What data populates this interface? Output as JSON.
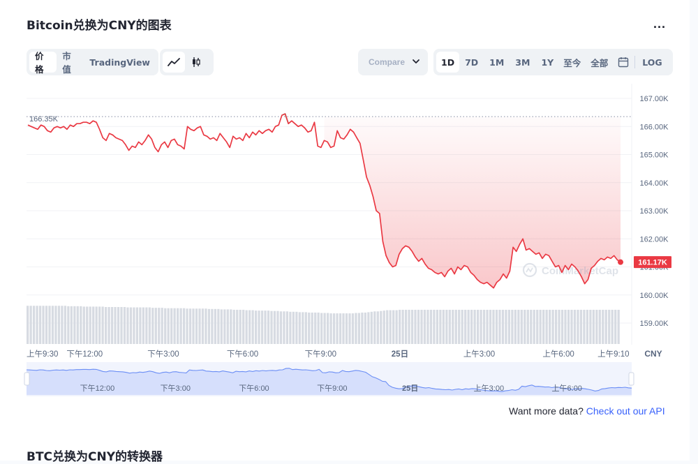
{
  "page": {
    "title": "Bitcoin兑换为CNY的图表",
    "more_label": "...",
    "view_tabs": [
      "价格",
      "市值",
      "TradingView"
    ],
    "compare_placeholder": "Compare",
    "ranges": [
      "1D",
      "7D",
      "1M",
      "3M",
      "1Y",
      "至今",
      "全部"
    ],
    "log_label": "LOG",
    "currency_label": "CNY",
    "watermark": "CoinMarketCap",
    "footer_text": "Want more data?",
    "footer_link": "Check out our API",
    "bottom_title": "BTC兑换为CNY的转换器"
  },
  "colors": {
    "line": "#ea3943",
    "accent": "#3861fb",
    "up": "#16c784",
    "brush": "#3861fb"
  },
  "icons": {
    "line_chart": "line-chart-icon",
    "candlestick": "candlestick-icon",
    "calendar": "calendar-icon",
    "chevron": "chevron-down-icon"
  },
  "chart_data": {
    "type": "line",
    "ylim": [
      158.5,
      167.5
    ],
    "yticks": [
      "167.00K",
      "166.00K",
      "165.00K",
      "164.00K",
      "163.00K",
      "162.00K",
      "161.00K",
      "160.00K",
      "159.00K"
    ],
    "ytick_values": [
      167,
      166,
      165,
      164,
      163,
      162,
      161,
      160,
      159
    ],
    "xticks": [
      "上午9:30",
      "下午12:00",
      "下午3:00",
      "下午6:00",
      "下午9:00",
      "25日",
      "上午3:00",
      "上午6:00",
      "上午9:10"
    ],
    "xticks_t": [
      0,
      0.096,
      0.226,
      0.357,
      0.486,
      0.617,
      0.748,
      0.879,
      0.996
    ],
    "brush_ticks": [
      "下午12:00",
      "下午3:00",
      "下午6:00",
      "下午9:00",
      "25日",
      "上午3:00",
      "上午6:00"
    ],
    "brush_ticks_t": [
      0.117,
      0.246,
      0.376,
      0.505,
      0.634,
      0.764,
      0.893
    ],
    "open_label": "166.35K",
    "open_value": 166.35,
    "current_label": "161.17K",
    "current_value": 161.17,
    "series": [
      {
        "values": [
          166.05,
          166.0,
          165.95,
          165.9,
          166.05,
          166.0,
          165.85,
          165.8,
          165.95,
          166.0,
          165.95,
          166.0,
          165.9,
          166.05,
          166.0,
          166.1,
          166.1,
          166.15,
          166.15,
          166.1,
          166.2,
          166.15,
          165.9,
          165.6,
          165.5,
          165.75,
          165.7,
          165.6,
          165.55,
          165.5,
          165.35,
          165.15,
          165.3,
          165.25,
          165.45,
          165.35,
          165.5,
          165.7,
          165.55,
          165.25,
          165.1,
          165.35,
          165.45,
          165.25,
          165.5,
          165.55,
          165.35,
          165.3,
          165.2,
          166.0,
          165.9,
          165.85,
          165.95,
          166.0,
          165.7,
          165.65,
          165.55,
          165.6,
          165.5,
          165.75,
          165.6,
          165.45,
          165.25,
          165.65,
          165.55,
          165.6,
          165.5,
          165.75,
          165.6,
          165.8,
          165.7,
          165.85,
          165.75,
          165.85,
          165.9,
          165.8,
          166.0,
          166.05,
          166.4,
          166.45,
          166.1,
          166.2,
          166.1,
          166.0,
          166.05,
          165.95,
          165.8,
          165.85,
          166.15,
          165.3,
          165.25,
          165.5,
          165.45,
          165.25,
          165.3,
          165.85,
          165.6,
          165.55,
          165.7,
          165.9,
          165.8,
          165.6,
          165.4,
          164.8,
          164.2,
          163.9,
          163.5,
          163.0,
          162.9,
          161.9,
          161.4,
          161.15,
          161.0,
          161.05,
          161.45,
          161.65,
          161.75,
          161.7,
          161.55,
          161.35,
          161.2,
          161.3,
          161.1,
          160.95,
          160.9,
          160.8,
          160.75,
          160.8,
          160.65,
          160.85,
          160.95,
          160.75,
          161.0,
          160.9,
          161.05,
          161.0,
          160.8,
          160.7,
          160.55,
          160.45,
          160.4,
          160.45,
          160.35,
          160.25,
          160.45,
          160.55,
          160.75,
          160.6,
          160.85,
          161.7,
          161.55,
          161.8,
          162.0,
          161.6,
          161.65,
          161.55,
          161.45,
          161.5,
          161.3,
          161.45,
          161.4,
          161.2,
          161.0,
          161.05,
          160.8,
          161.05,
          160.9,
          161.1,
          161.0,
          160.85,
          160.65,
          160.4,
          160.55,
          160.95,
          161.05,
          161.2,
          161.3,
          161.25,
          161.35,
          161.3,
          161.4,
          161.25,
          161.17
        ]
      }
    ],
    "volume": [
      0.96,
      0.96,
      0.96,
      0.96,
      0.96,
      0.96,
      0.96,
      0.96,
      0.96,
      0.96,
      0.96,
      0.96,
      0.96,
      0.95,
      0.95,
      0.95,
      0.95,
      0.95,
      0.94,
      0.94,
      0.94,
      0.94,
      0.94,
      0.94,
      0.94,
      0.93,
      0.93,
      0.93,
      0.93,
      0.93,
      0.93,
      0.93,
      0.92,
      0.92,
      0.92,
      0.92,
      0.92,
      0.92,
      0.92,
      0.92,
      0.91,
      0.91,
      0.91,
      0.91,
      0.9,
      0.9,
      0.9,
      0.9,
      0.9,
      0.9,
      0.9,
      0.89,
      0.89,
      0.89,
      0.89,
      0.89,
      0.89,
      0.89,
      0.88,
      0.88,
      0.88,
      0.88,
      0.87,
      0.87,
      0.87,
      0.87,
      0.86,
      0.86,
      0.86,
      0.86,
      0.85,
      0.85,
      0.85,
      0.84,
      0.84,
      0.84,
      0.84,
      0.84,
      0.83,
      0.83,
      0.83,
      0.82,
      0.82,
      0.82,
      0.81,
      0.81,
      0.81,
      0.8,
      0.8,
      0.8,
      0.79,
      0.79,
      0.79,
      0.79,
      0.78,
      0.78,
      0.78,
      0.77,
      0.77,
      0.77,
      0.77,
      0.77,
      0.77,
      0.77,
      0.77,
      0.78,
      0.78,
      0.79,
      0.79,
      0.8,
      0.81,
      0.82,
      0.82,
      0.83,
      0.84,
      0.85,
      0.85,
      0.85,
      0.85,
      0.86,
      0.86,
      0.86,
      0.86,
      0.86,
      0.86,
      0.86,
      0.86,
      0.86,
      0.86,
      0.86,
      0.86,
      0.86,
      0.86,
      0.86,
      0.86,
      0.86,
      0.86,
      0.86,
      0.86,
      0.86,
      0.86,
      0.86,
      0.86,
      0.86,
      0.86,
      0.86,
      0.86,
      0.86,
      0.86,
      0.86,
      0.86,
      0.86,
      0.86,
      0.86,
      0.86,
      0.86,
      0.86,
      0.86,
      0.86,
      0.86,
      0.86,
      0.86,
      0.86,
      0.86,
      0.86,
      0.86,
      0.86,
      0.86,
      0.86,
      0.86,
      0.86,
      0.86,
      0.86,
      0.86,
      0.86,
      0.86,
      0.86,
      0.86,
      0.86,
      0.86,
      0.86,
      0.86,
      0.86,
      0.86,
      0.86,
      0.86,
      0.86,
      0.86,
      0.86,
      0.86
    ]
  }
}
